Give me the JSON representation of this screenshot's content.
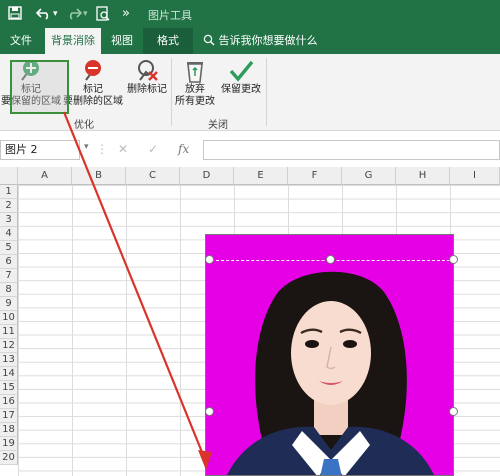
{
  "titlebar": {
    "title": "图片工具",
    "save_icon": "save-icon",
    "undo_icon": "undo-icon",
    "redo_icon": "redo-icon",
    "preview_icon": "print-preview-icon",
    "more": "»"
  },
  "tabs": [
    {
      "label": "文件"
    },
    {
      "label": "背景消除"
    },
    {
      "label": "视图"
    },
    {
      "label": "格式"
    }
  ],
  "tell_me": "告诉我你想要做什么",
  "ribbon": {
    "mark_keep_line1": "标记",
    "mark_keep_line2": "要保留的区域",
    "mark_remove_line1": "标记",
    "mark_remove_line2": "要删除的区域",
    "delete_mark": "删除标记",
    "discard_line1": "放弃",
    "discard_line2": "所有更改",
    "keep_changes": "保留更改",
    "group_optimize": "优化",
    "group_close": "关闭"
  },
  "formula_bar": {
    "name_box": "图片 2",
    "fx": "fx",
    "cancel": "✕",
    "confirm": "✓",
    "value": ""
  },
  "sheet": {
    "columns": [
      "A",
      "B",
      "C",
      "D",
      "E",
      "F",
      "G",
      "H",
      "I"
    ],
    "rows": [
      "1",
      "2",
      "3",
      "4",
      "5",
      "6",
      "7",
      "8",
      "9",
      "10",
      "11",
      "12",
      "13",
      "14",
      "15",
      "16",
      "17",
      "18",
      "19",
      "20"
    ]
  },
  "colors": {
    "excel_green": "#217346",
    "removal_magenta": "#e600e6",
    "arrow_red": "#d9342b"
  }
}
